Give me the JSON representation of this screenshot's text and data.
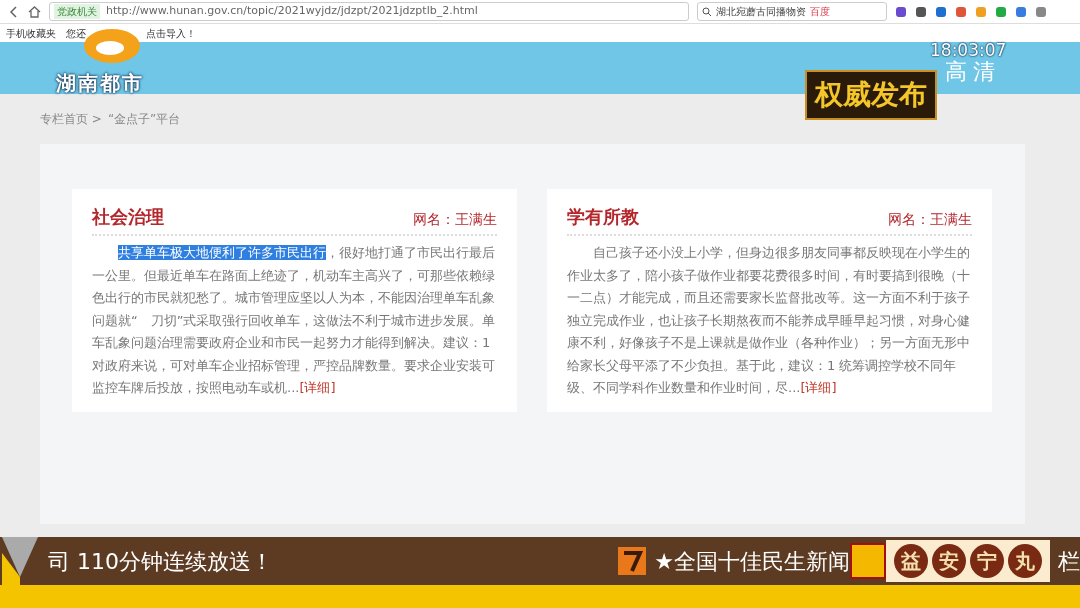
{
  "browser": {
    "site_tag": "党政机关",
    "url": "http://www.hunan.gov.cn/topic/2021wyjdz/jdzpt/2021jdzptlb_2.html",
    "search_value": "湖北宛蘑古同播物资",
    "search_hint": "百度",
    "bookmarks": [
      "手机收藏夹",
      "您还",
      "点击导入！"
    ]
  },
  "breadcrumb": [
    "专栏首页 >",
    "“金点子”平台"
  ],
  "cards": [
    {
      "title": "社会治理",
      "author": "网名：王满生",
      "selection": "共享单车极大地便利了许多市民出行",
      "text": "，很好地打通了市民出行最后一公里。但最近单车在路面上绝迹了，机动车主高兴了，可那些依赖绿色出行的市民就犯愁了。城市管理应坚以人为本，不能因治理单车乱象问题就“　刀切”式采取强行回收单车，这做法不利于城市进步发展。单车乱象问题治理需要政府企业和市民一起努力才能得到解决。建议：1 对政府来说，可对单车企业招标管理，严控品牌数量。要求企业安装可监控车牌后投放，按照电动车或机...",
      "more": "[详细]"
    },
    {
      "title": "学有所教",
      "author": "网名：王满生",
      "text": "自己孩子还小没上小学，但身边很多朋友同事都反映现在小学生的作业太多了，陪小孩子做作业都要花费很多时间，有时要搞到很晚（十一二点）才能完成，而且还需要家长监督批改等。这一方面不利于孩子独立完成作业，也让孩子长期熬夜而不能养成早睡早起习惯，对身心健康不利，好像孩子不是上课就是做作业（各种作业）；另一方面无形中给家长父母平添了不少负担。基于此，建议：1 统筹调控学校不同年级、不同学科作业数量和作业时间，尽...",
      "more": "[详细]"
    }
  ],
  "tv_overlay": {
    "channel": "湖南都市",
    "clock": "18:03:07",
    "quality": "高清",
    "badge": "权威发布"
  },
  "ticker": {
    "text": "司 110分钟连续放送！",
    "headline": "★全国十佳民生新闻",
    "sponsor": [
      "益",
      "安",
      "宁",
      "丸"
    ],
    "tail": "栏"
  }
}
